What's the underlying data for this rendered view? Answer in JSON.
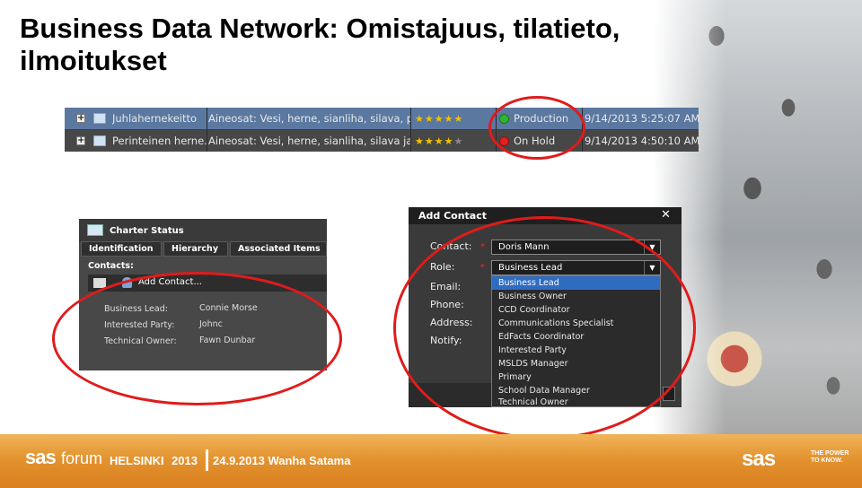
{
  "slide": {
    "title": "Business Data Network: Omistajuus, tilatieto, ilmoitukset"
  },
  "grid": {
    "rows": [
      {
        "name": "Juhlahernekeitto",
        "ingredients": "Aineosat: Vesi, herne, sianliha, silava, por...",
        "rating": 5,
        "status": "Production",
        "status_color": "#2fb52f",
        "timestamp": "9/14/2013 5:25:07 AM"
      },
      {
        "name": "Perinteinen herne...",
        "ingredients": "Aineosat: Vesi, herne, sianliha, silava ja s...",
        "rating": 4,
        "status": "On Hold",
        "status_color": "#e02020",
        "timestamp": "9/14/2013 4:50:10 AM"
      }
    ]
  },
  "charter": {
    "title": "Charter Status",
    "tabs": [
      "Identification",
      "Hierarchy",
      "Associated Items"
    ],
    "contacts_label": "Contacts:",
    "add_contact_label": "Add Contact...",
    "contacts": [
      {
        "role": "Business Lead:",
        "name": "Connie Morse"
      },
      {
        "role": "Interested Party:",
        "name": "Johnc"
      },
      {
        "role": "Technical Owner:",
        "name": "Fawn Dunbar"
      }
    ]
  },
  "add_contact": {
    "title": "Add Contact",
    "close_glyph": "✕",
    "fields": {
      "contact_label": "Contact:",
      "contact_value": "Doris Mann",
      "role_label": "Role:",
      "role_value": "Business Lead",
      "email_label": "Email:",
      "phone_label": "Phone:",
      "address_label": "Address:",
      "notify_label": "Notify:"
    },
    "required_marker": "*",
    "role_options": [
      "Business Lead",
      "Business Owner",
      "CCD Coordinator",
      "Communications Specialist",
      "EdFacts Coordinator",
      "Interested Party",
      "MSLDS Manager",
      "Primary",
      "School Data Manager",
      "Technical Owner"
    ]
  },
  "footer": {
    "sas": "sas",
    "forum": "forum",
    "city": "HELSINKI",
    "year": "2013",
    "event": "24.9.2013 Wanha Satama",
    "logo": "sas",
    "tagline": "THE POWER TO KNOW."
  },
  "colors": {
    "accent_orange": "#e3932f",
    "highlight_red": "#e01b1b",
    "selection_blue": "#2f6cc0"
  }
}
